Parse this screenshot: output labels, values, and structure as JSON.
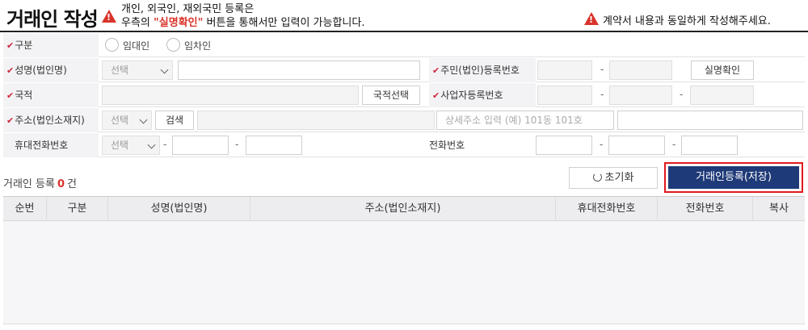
{
  "header": {
    "title": "거래인 작성",
    "notice_line1": "개인, 외국인, 재외국민 등록은",
    "notice_line2_prefix": "우측의 ",
    "notice_line2_highlight": "\"실명확인\"",
    "notice_line2_suffix": " 버튼을 통해서만 입력이 가능합니다.",
    "right_notice": "계약서 내용과 동일하게 작성해주세요."
  },
  "form": {
    "type": {
      "label": "구분",
      "options": [
        "임대인",
        "임차인"
      ]
    },
    "name": {
      "label": "성명(법인명)",
      "select": "선택"
    },
    "reg_no": {
      "label": "주민(법인)등록번호",
      "dash": "-",
      "verify_button": "실명확인"
    },
    "nationality": {
      "label": "국적",
      "button": "국적선택"
    },
    "biz_no": {
      "label": "사업자등록번호",
      "dash": "-"
    },
    "address": {
      "label": "주소(법인소재지)",
      "select": "선택",
      "search_button": "검색",
      "detail_placeholder": "상세주소 입력 (예) 101동 101호"
    },
    "mobile": {
      "label": "휴대전화번호",
      "select": "선택",
      "dash": "-"
    },
    "phone": {
      "label": "전화번호",
      "dash": "-"
    }
  },
  "registry": {
    "label": "거래인 등록",
    "count": "0",
    "unit": "건",
    "reset_button": "초기화",
    "register_button": "거래인등록(저장)"
  },
  "table": {
    "columns": [
      "순번",
      "구분",
      "성명(법인명)",
      "주소(법인소재지)",
      "휴대전화번호",
      "전화번호",
      "복사"
    ],
    "rows": []
  },
  "colors": {
    "accent": "#1f3a78",
    "warning": "#d9342b",
    "highlight_border": "#e0191f"
  }
}
